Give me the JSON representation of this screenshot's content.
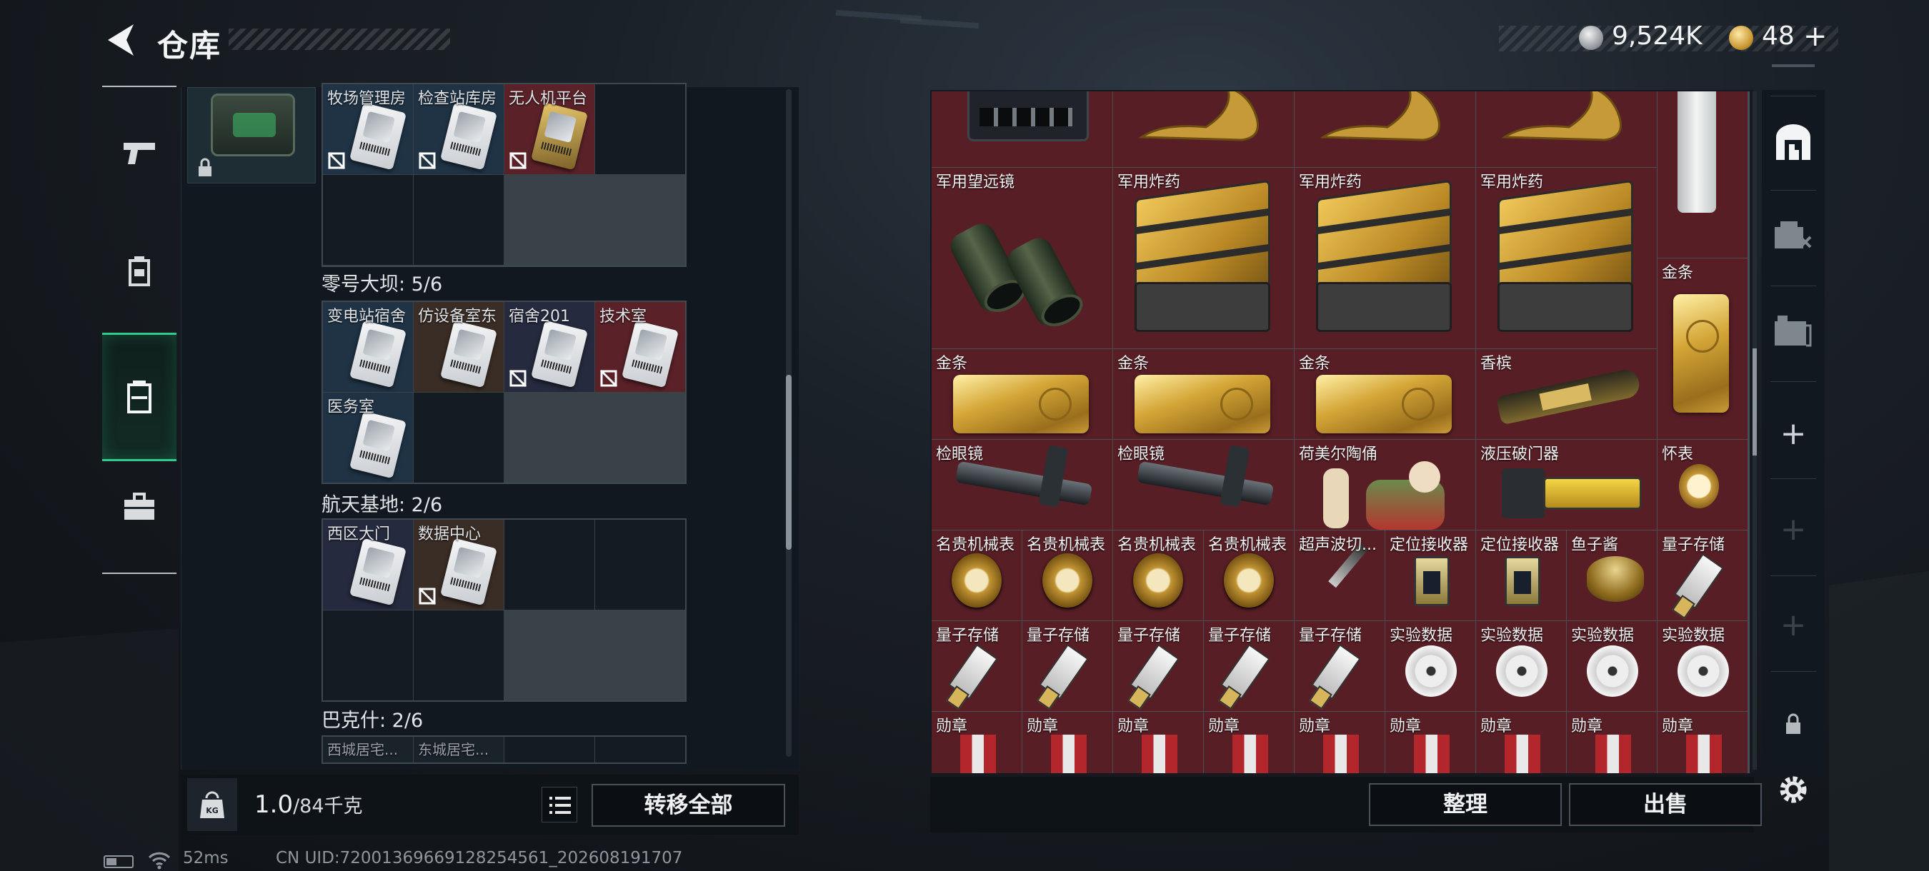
{
  "header": {
    "title": "仓库",
    "currency_silver": "9,524K",
    "currency_gold": "48",
    "currency_add": "+"
  },
  "nav": {
    "items": [
      "weapons-icon",
      "armor-icon",
      "backpack-icon",
      "toolbox-icon"
    ],
    "active_index": 2
  },
  "left_panel": {
    "top_row_labels": [
      "牧场管理房",
      "检查站库房",
      "无人机平台"
    ],
    "sections": [
      {
        "title": "零号大坝: 5/6",
        "keys": [
          "变电站宿舍",
          "仿设备室东",
          "宿舍201",
          "技术室",
          "医务室"
        ]
      },
      {
        "title": "航天基地: 2/6",
        "keys": [
          "西区大门",
          "数据中心"
        ]
      },
      {
        "title": "巴克什: 2/6",
        "keys": [
          "西城居宅...",
          "东城居宅..."
        ]
      }
    ],
    "capacity_value": "1.0",
    "capacity_max": "/84千克",
    "transfer_all": "转移全部"
  },
  "right_panel": {
    "rows": [
      [
        "",
        "",
        "",
        ""
      ],
      [
        "军用望远镜",
        "军用炸药",
        "军用炸药",
        "军用炸药",
        ""
      ],
      [
        "金条",
        "金条",
        "金条",
        "香槟",
        "金条"
      ],
      [
        "检眼镜",
        "检眼镜",
        "荷美尔陶俑",
        "液压破门器",
        "怀表"
      ],
      [
        "名贵机械表",
        "名贵机械表",
        "名贵机械表",
        "名贵机械表",
        "超声波切...",
        "定位接收器",
        "定位接收器",
        "鱼子酱",
        "量子存储"
      ],
      [
        "量子存储",
        "量子存储",
        "量子存储",
        "量子存储",
        "量子存储",
        "实验数据",
        "实验数据",
        "实验数据",
        "实验数据"
      ],
      [
        "勋章",
        "勋章",
        "勋章",
        "勋章",
        "勋章",
        "勋章",
        "勋章",
        "勋章",
        "勋章"
      ]
    ],
    "organize": "整理",
    "sell": "出售"
  },
  "status_bar": {
    "ping": "52ms",
    "uid": "CN UID:72001369669128254561_202608191707"
  }
}
